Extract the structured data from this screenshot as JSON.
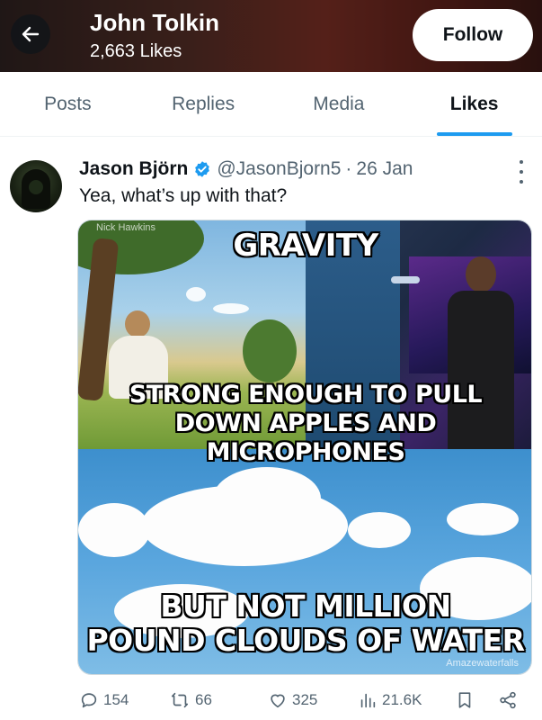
{
  "header": {
    "name": "John Tolkin",
    "likes_count": "2,663 Likes",
    "follow_label": "Follow"
  },
  "tabs": [
    {
      "label": "Posts",
      "active": false
    },
    {
      "label": "Replies",
      "active": false
    },
    {
      "label": "Media",
      "active": false
    },
    {
      "label": "Likes",
      "active": true
    }
  ],
  "post": {
    "author": "Jason Björn",
    "handle": "@JasonBjorn5",
    "separator": "·",
    "date": "26 Jan",
    "text": "Yea, what’s up with that?",
    "meme": {
      "title": "GRAVITY",
      "top_line_1": "STRONG ENOUGH TO PULL",
      "top_line_2": "DOWN APPLES AND MICROPHONES",
      "bottom_line_1": "BUT NOT MILLION",
      "bottom_line_2": "POUND CLOUDS OF WATER",
      "watermark_top": "Nick Hawkins",
      "watermark_bottom": "Amazewaterfalls"
    },
    "stats": {
      "replies": "154",
      "reposts": "66",
      "likes": "325",
      "views": "21.6K"
    }
  },
  "colors": {
    "accent": "#1d9bf0",
    "text_primary": "#0f1419",
    "text_secondary": "#536471",
    "verified": "#1d9bf0"
  },
  "icons": [
    "arrow-left-icon",
    "verified-badge-icon",
    "more-dots-icon",
    "reply-icon",
    "repost-icon",
    "like-icon",
    "views-icon",
    "bookmark-icon",
    "share-icon"
  ]
}
